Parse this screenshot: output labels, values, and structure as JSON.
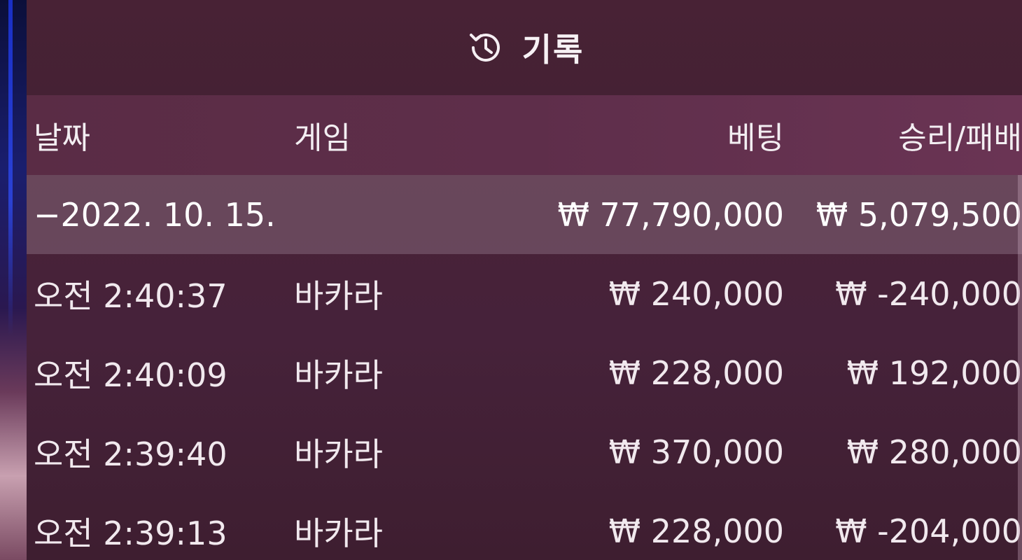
{
  "header": {
    "title": "기록",
    "icon": "history-icon"
  },
  "columns": {
    "date": "날짜",
    "game": "게임",
    "bet": "베팅",
    "result": "승리/패배"
  },
  "summary": {
    "date": "−2022. 10. 15.",
    "bet": "₩ 77,790,000",
    "result": "₩ 5,079,500"
  },
  "rows": [
    {
      "time": "오전 2:40:37",
      "game": "바카라",
      "bet": "₩ 240,000",
      "result": "₩ -240,000"
    },
    {
      "time": "오전 2:40:09",
      "game": "바카라",
      "bet": "₩ 228,000",
      "result": "₩ 192,000"
    },
    {
      "time": "오전 2:39:40",
      "game": "바카라",
      "bet": "₩ 370,000",
      "result": "₩ 280,000"
    },
    {
      "time": "오전 2:39:13",
      "game": "바카라",
      "bet": "₩ 228,000",
      "result": "₩ -204,000"
    }
  ],
  "colors": {
    "panel": "#4a2236",
    "header_row": "#5e2e4a",
    "summary_row": "#7a5a6a",
    "text": "#ffffff"
  }
}
